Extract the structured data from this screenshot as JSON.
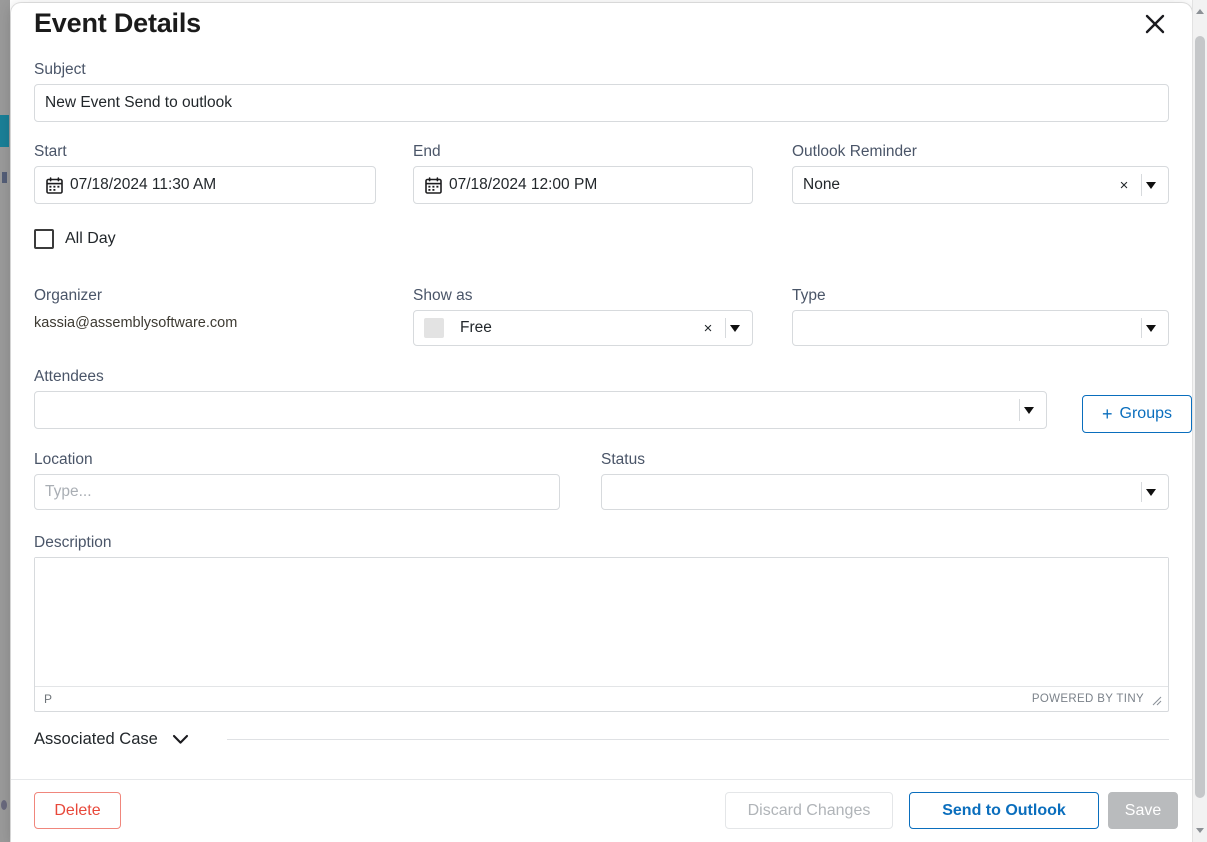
{
  "modal": {
    "title": "Event Details",
    "close_icon": "close-icon"
  },
  "subject": {
    "label": "Subject",
    "value": "New Event Send to outlook"
  },
  "start": {
    "label": "Start",
    "value": "07/18/2024 11:30 AM",
    "icon": "calendar-icon"
  },
  "end": {
    "label": "End",
    "value": "07/18/2024 12:00 PM",
    "icon": "calendar-icon"
  },
  "reminder": {
    "label": "Outlook Reminder",
    "value": "None",
    "clear_label": "×"
  },
  "all_day": {
    "label": "All Day",
    "checked": false
  },
  "organizer": {
    "label": "Organizer",
    "value": "kassia@assemblysoftware.com"
  },
  "show_as": {
    "label": "Show as",
    "value": "Free",
    "swatch_color": "#e3e3e3",
    "clear_label": "×"
  },
  "type": {
    "label": "Type",
    "value": ""
  },
  "attendees": {
    "label": "Attendees",
    "value": "",
    "groups_button": "Groups",
    "groups_plus": "+"
  },
  "location": {
    "label": "Location",
    "value": "",
    "placeholder": "Type..."
  },
  "status": {
    "label": "Status",
    "value": ""
  },
  "description": {
    "label": "Description",
    "value": "",
    "editor_path": "P",
    "branding": "POWERED BY TINY"
  },
  "associated_case": {
    "label": "Associated Case",
    "chevron_icon": "chevron-down-icon"
  },
  "footer": {
    "delete_label": "Delete",
    "discard_label": "Discard Changes",
    "send_outlook_label": "Send to Outlook",
    "save_label": "Save"
  },
  "colors": {
    "accent_blue": "#0a6ebd",
    "danger_red": "#e8483a",
    "disabled_gray": "#b9bbbd",
    "border": "#d7dadd",
    "label_text": "#4a5568"
  }
}
